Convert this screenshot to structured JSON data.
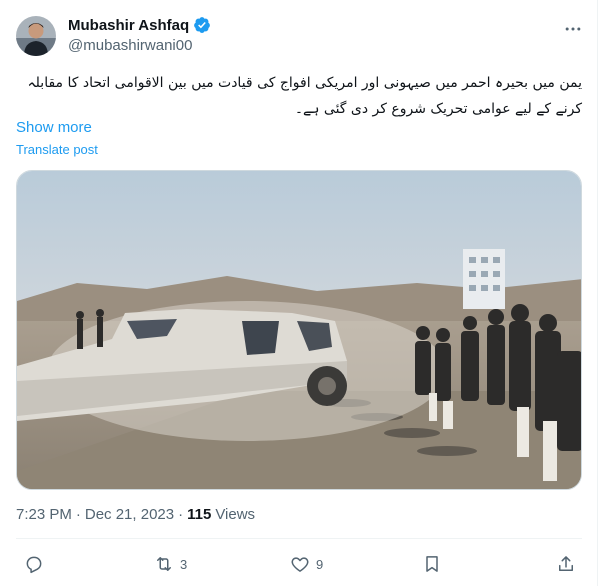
{
  "author": {
    "display_name": "Mubashir Ashfaq",
    "handle": "@mubashirwani00",
    "verified": true
  },
  "post": {
    "text": "یمن میں بحیرہ احمر میں صیہونی اور امریکی افواج کی قیادت میں بین الاقوامی اتحاد کا مقابلہ کرنے کے لیے عوامی تحریک شروع کر دی گئی ہے۔",
    "show_more": "Show more",
    "translate": "Translate post"
  },
  "meta": {
    "time": "7:23 PM",
    "separator": "·",
    "date": "Dec 21, 2023",
    "views_count": "115",
    "views_label": "Views"
  },
  "actions": {
    "retweets": "3",
    "likes": "9"
  },
  "colors": {
    "accent": "#1d9bf0",
    "muted": "#536471",
    "text": "#0f1419",
    "border": "#eff3f4"
  },
  "icons": [
    "verified-badge-icon",
    "more-icon",
    "reply-icon",
    "retweet-icon",
    "like-icon",
    "bookmark-icon",
    "share-icon"
  ]
}
